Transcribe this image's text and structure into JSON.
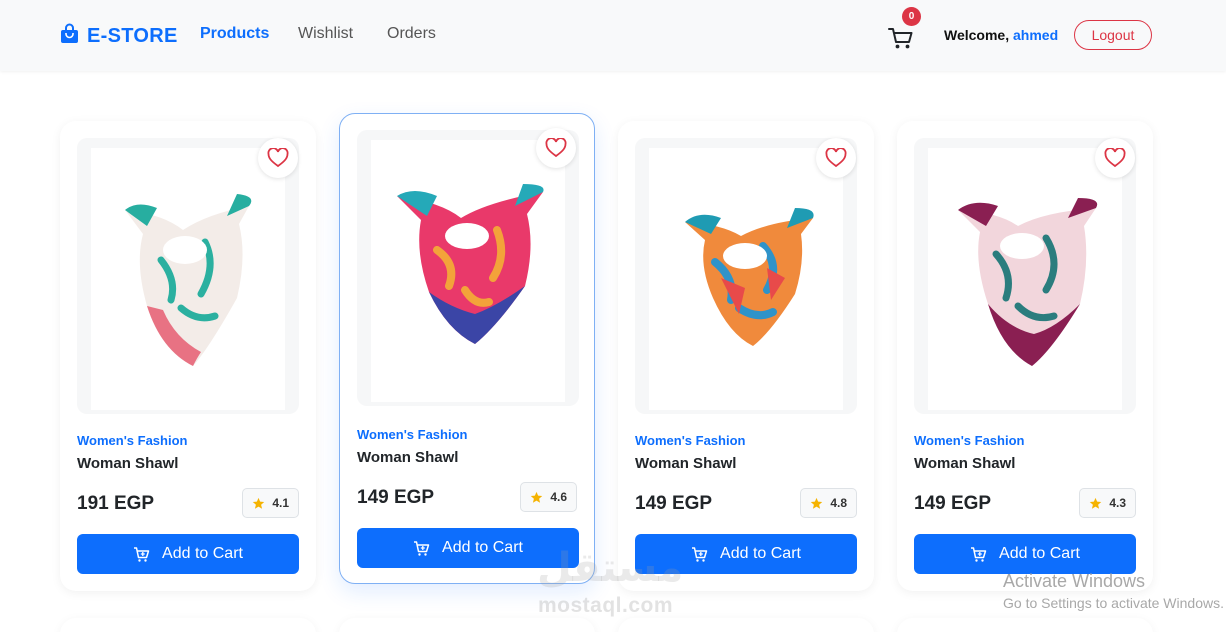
{
  "navbar": {
    "brand": "E-STORE",
    "links": [
      "Products",
      "Wishlist",
      "Orders"
    ],
    "cart_count": "0",
    "welcome_prefix": "Welcome,",
    "username": "ahmed",
    "logout_label": "Logout"
  },
  "products": [
    {
      "category": "Women's Fashion",
      "title": "Woman Shawl",
      "price": "191 EGP",
      "rating": "4.1"
    },
    {
      "category": "Women's Fashion",
      "title": "Woman Shawl",
      "price": "149 EGP",
      "rating": "4.6"
    },
    {
      "category": "Women's Fashion",
      "title": "Woman Shawl",
      "price": "149 EGP",
      "rating": "4.8"
    },
    {
      "category": "Women's Fashion",
      "title": "Woman Shawl",
      "price": "149 EGP",
      "rating": "4.3"
    }
  ],
  "add_to_cart_label": "Add to Cart",
  "watermark": {
    "logo": "مستقل",
    "text": "mostaql.com"
  },
  "os_notice": {
    "title": "Activate Windows",
    "subtitle": "Go to Settings to activate Windows."
  },
  "colors": {
    "primary": "#0d6efd",
    "danger": "#dc3545",
    "star": "#f5b301"
  }
}
